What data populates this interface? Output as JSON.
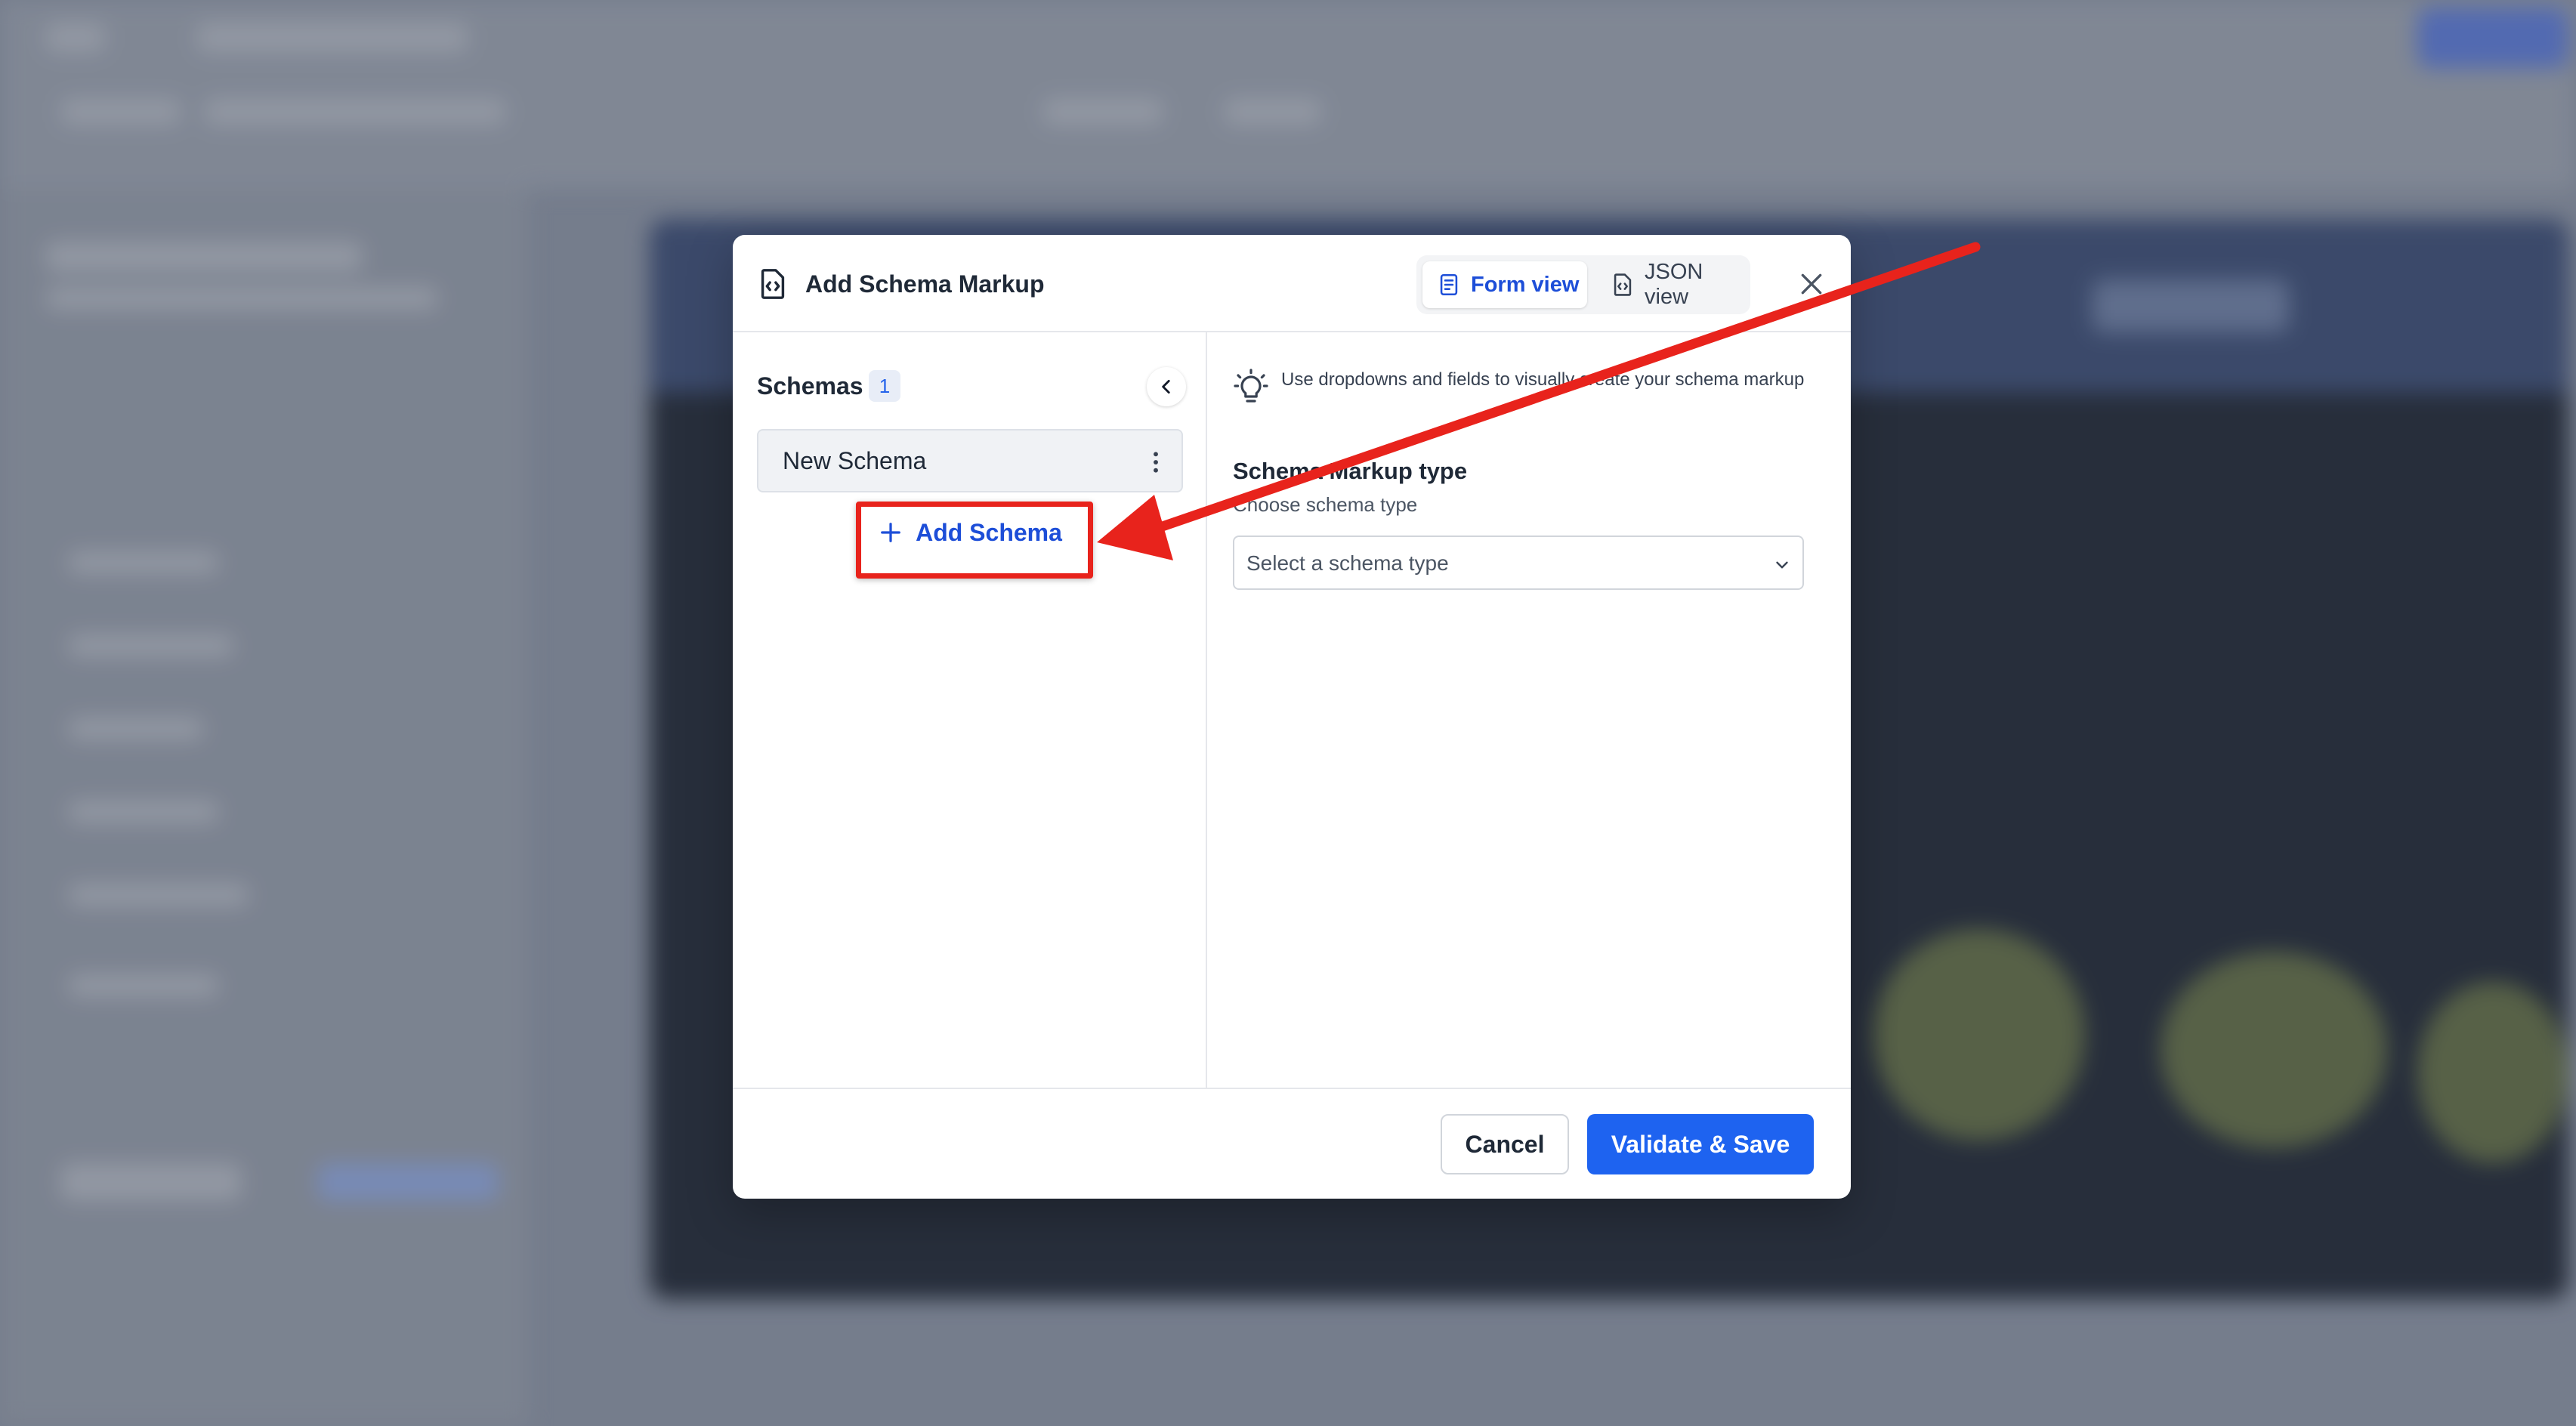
{
  "modal": {
    "title": "Add Schema Markup",
    "tabs": [
      {
        "label": "Form view",
        "active": true,
        "icon": "form-icon"
      },
      {
        "label": "JSON view",
        "active": false,
        "icon": "json-file-icon"
      }
    ],
    "close_icon": "close-icon"
  },
  "left_panel": {
    "schemas_label": "Schemas",
    "schemas_count": "1",
    "items": [
      {
        "label": "New Schema"
      }
    ],
    "add_button_label": "Add Schema"
  },
  "right_panel": {
    "tip_text": "Use dropdowns and fields to visually create your schema markup",
    "type_label": "Schema Markup type",
    "type_help": "Choose schema type",
    "type_select_placeholder": "Select a schema type"
  },
  "footer": {
    "cancel_label": "Cancel",
    "save_label": "Validate & Save"
  },
  "annotation": {
    "color": "#e8231c",
    "target": "add-schema-button"
  },
  "colors": {
    "accent": "#1d4ed8",
    "primary_button": "#1e63f0"
  }
}
